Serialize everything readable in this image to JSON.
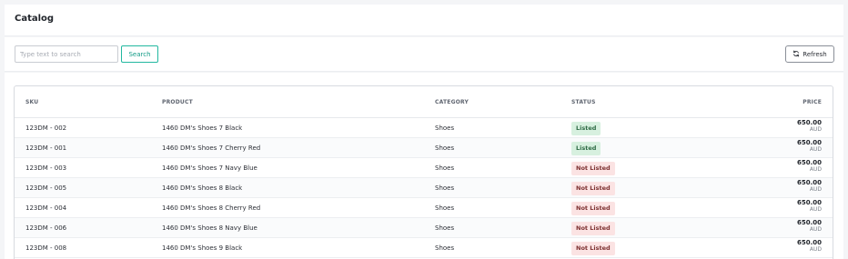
{
  "header": {
    "title": "Catalog"
  },
  "toolbar": {
    "search_placeholder": "Type text to search",
    "search_value": "",
    "search_label": "Search",
    "refresh_label": "Refresh"
  },
  "table": {
    "columns": {
      "sku": "SKU",
      "product": "PRODUCT",
      "category": "CATEGORY",
      "status": "STATUS",
      "price": "PRICE"
    },
    "rows": [
      {
        "sku": "123DM - 002",
        "product": "1460 DM's Shoes 7 Black",
        "category": "Shoes",
        "status": "Listed",
        "price": "650.00",
        "currency": "AUD"
      },
      {
        "sku": "123DM - 001",
        "product": "1460 DM's Shoes 7 Cherry Red",
        "category": "Shoes",
        "status": "Listed",
        "price": "650.00",
        "currency": "AUD"
      },
      {
        "sku": "123DM - 003",
        "product": "1460 DM's Shoes 7 Navy Blue",
        "category": "Shoes",
        "status": "Not Listed",
        "price": "650.00",
        "currency": "AUD"
      },
      {
        "sku": "123DM - 005",
        "product": "1460 DM's Shoes 8 Black",
        "category": "Shoes",
        "status": "Not Listed",
        "price": "650.00",
        "currency": "AUD"
      },
      {
        "sku": "123DM - 004",
        "product": "1460 DM's Shoes 8 Cherry Red",
        "category": "Shoes",
        "status": "Not Listed",
        "price": "650.00",
        "currency": "AUD"
      },
      {
        "sku": "123DM - 006",
        "product": "1460 DM's Shoes 8 Navy Blue",
        "category": "Shoes",
        "status": "Not Listed",
        "price": "650.00",
        "currency": "AUD"
      },
      {
        "sku": "123DM - 008",
        "product": "1460 DM's Shoes 9 Black",
        "category": "Shoes",
        "status": "Not Listed",
        "price": "650.00",
        "currency": "AUD"
      }
    ]
  },
  "icons": {
    "refresh": "refresh-icon"
  },
  "colors": {
    "accent": "#22b8a0",
    "listed_bg": "#d7f0df",
    "not_listed_bg": "#fbe3e3"
  }
}
